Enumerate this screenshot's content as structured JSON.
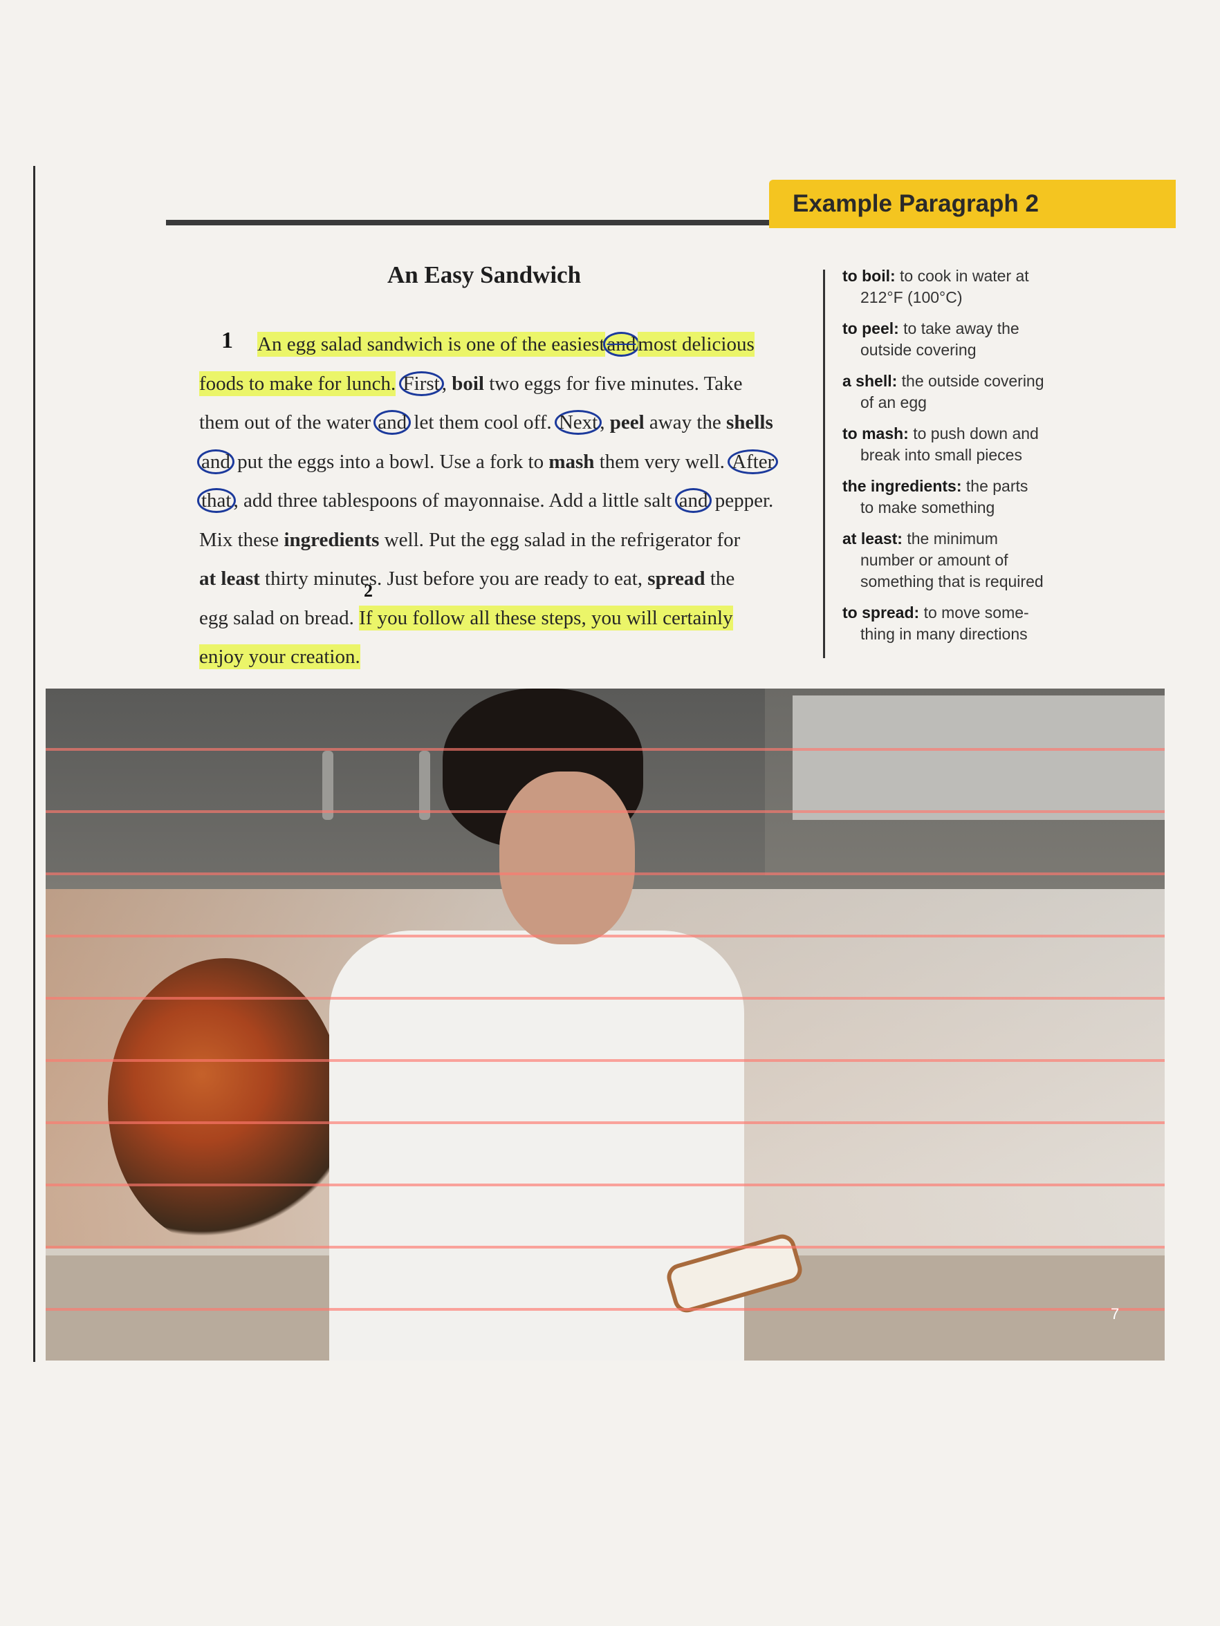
{
  "header": {
    "tab_label": "Example Paragraph 2"
  },
  "article": {
    "title": "An Easy Sandwich",
    "paragraph_marker": "1",
    "step_marker": "2",
    "lines": [
      {
        "segments": [
          {
            "t": "An egg salad sandwich is one of the easiest",
            "s": "hl"
          },
          {
            "t": "and",
            "s": "circ-strike-hl"
          },
          {
            "t": "most delicious",
            "s": "hl"
          }
        ]
      },
      {
        "segments": [
          {
            "t": "foods to make for lunch.",
            "s": "hl"
          },
          {
            "t": " "
          },
          {
            "t": "First",
            "s": "circ"
          },
          {
            "t": ", "
          },
          {
            "t": "boil",
            "s": "b"
          },
          {
            "t": " two eggs for five minutes. Take"
          }
        ]
      },
      {
        "segments": [
          {
            "t": "them out of the water "
          },
          {
            "t": "and",
            "s": "circ"
          },
          {
            "t": " let them cool off. "
          },
          {
            "t": "Next",
            "s": "circ"
          },
          {
            "t": ", "
          },
          {
            "t": "peel",
            "s": "b"
          },
          {
            "t": " away the "
          },
          {
            "t": "shells",
            "s": "b"
          }
        ]
      },
      {
        "segments": [
          {
            "t": "and",
            "s": "circ"
          },
          {
            "t": " put the eggs into a bowl. Use a fork to "
          },
          {
            "t": "mash",
            "s": "b"
          },
          {
            "t": " them very well. "
          },
          {
            "t": "After",
            "s": "circ"
          }
        ]
      },
      {
        "segments": [
          {
            "t": "that",
            "s": "circ"
          },
          {
            "t": ", add three tablespoons of mayonnaise. Add a little salt "
          },
          {
            "t": "and",
            "s": "circ"
          },
          {
            "t": " pepper."
          }
        ]
      },
      {
        "segments": [
          {
            "t": "Mix these "
          },
          {
            "t": "ingredients",
            "s": "b"
          },
          {
            "t": " well. Put the egg salad in the refrigerator for"
          }
        ]
      },
      {
        "segments": [
          {
            "t": "at least",
            "s": "b"
          },
          {
            "t": " thirty minutes. Just before you are ready to eat, "
          },
          {
            "t": "spread",
            "s": "b"
          },
          {
            "t": " the"
          }
        ]
      },
      {
        "segments": [
          {
            "t": "egg salad on bread. "
          },
          {
            "t": "If you follow all these steps, you will certainly",
            "s": "hl"
          }
        ]
      },
      {
        "segments": [
          {
            "t": "enjoy your creation.",
            "s": "hl"
          }
        ]
      }
    ]
  },
  "glossary": [
    {
      "term": "to boil:",
      "def": "to cook in water at",
      "cont": "212°F (100°C)"
    },
    {
      "term": "to peel:",
      "def": "to take away the",
      "cont": "outside covering"
    },
    {
      "term": "a shell:",
      "def": "the outside covering",
      "cont": "of an egg"
    },
    {
      "term": "to mash:",
      "def": "to push down and",
      "cont": "break into small pieces"
    },
    {
      "term": "the ingredients:",
      "def": "the parts",
      "cont": "to make something"
    },
    {
      "term": "at least:",
      "def": "the minimum",
      "cont": "number or amount of something that is required"
    },
    {
      "term": "to spread:",
      "def": "to move some-",
      "cont": "thing in many directions"
    }
  ],
  "photo": {
    "page_number": "7"
  }
}
